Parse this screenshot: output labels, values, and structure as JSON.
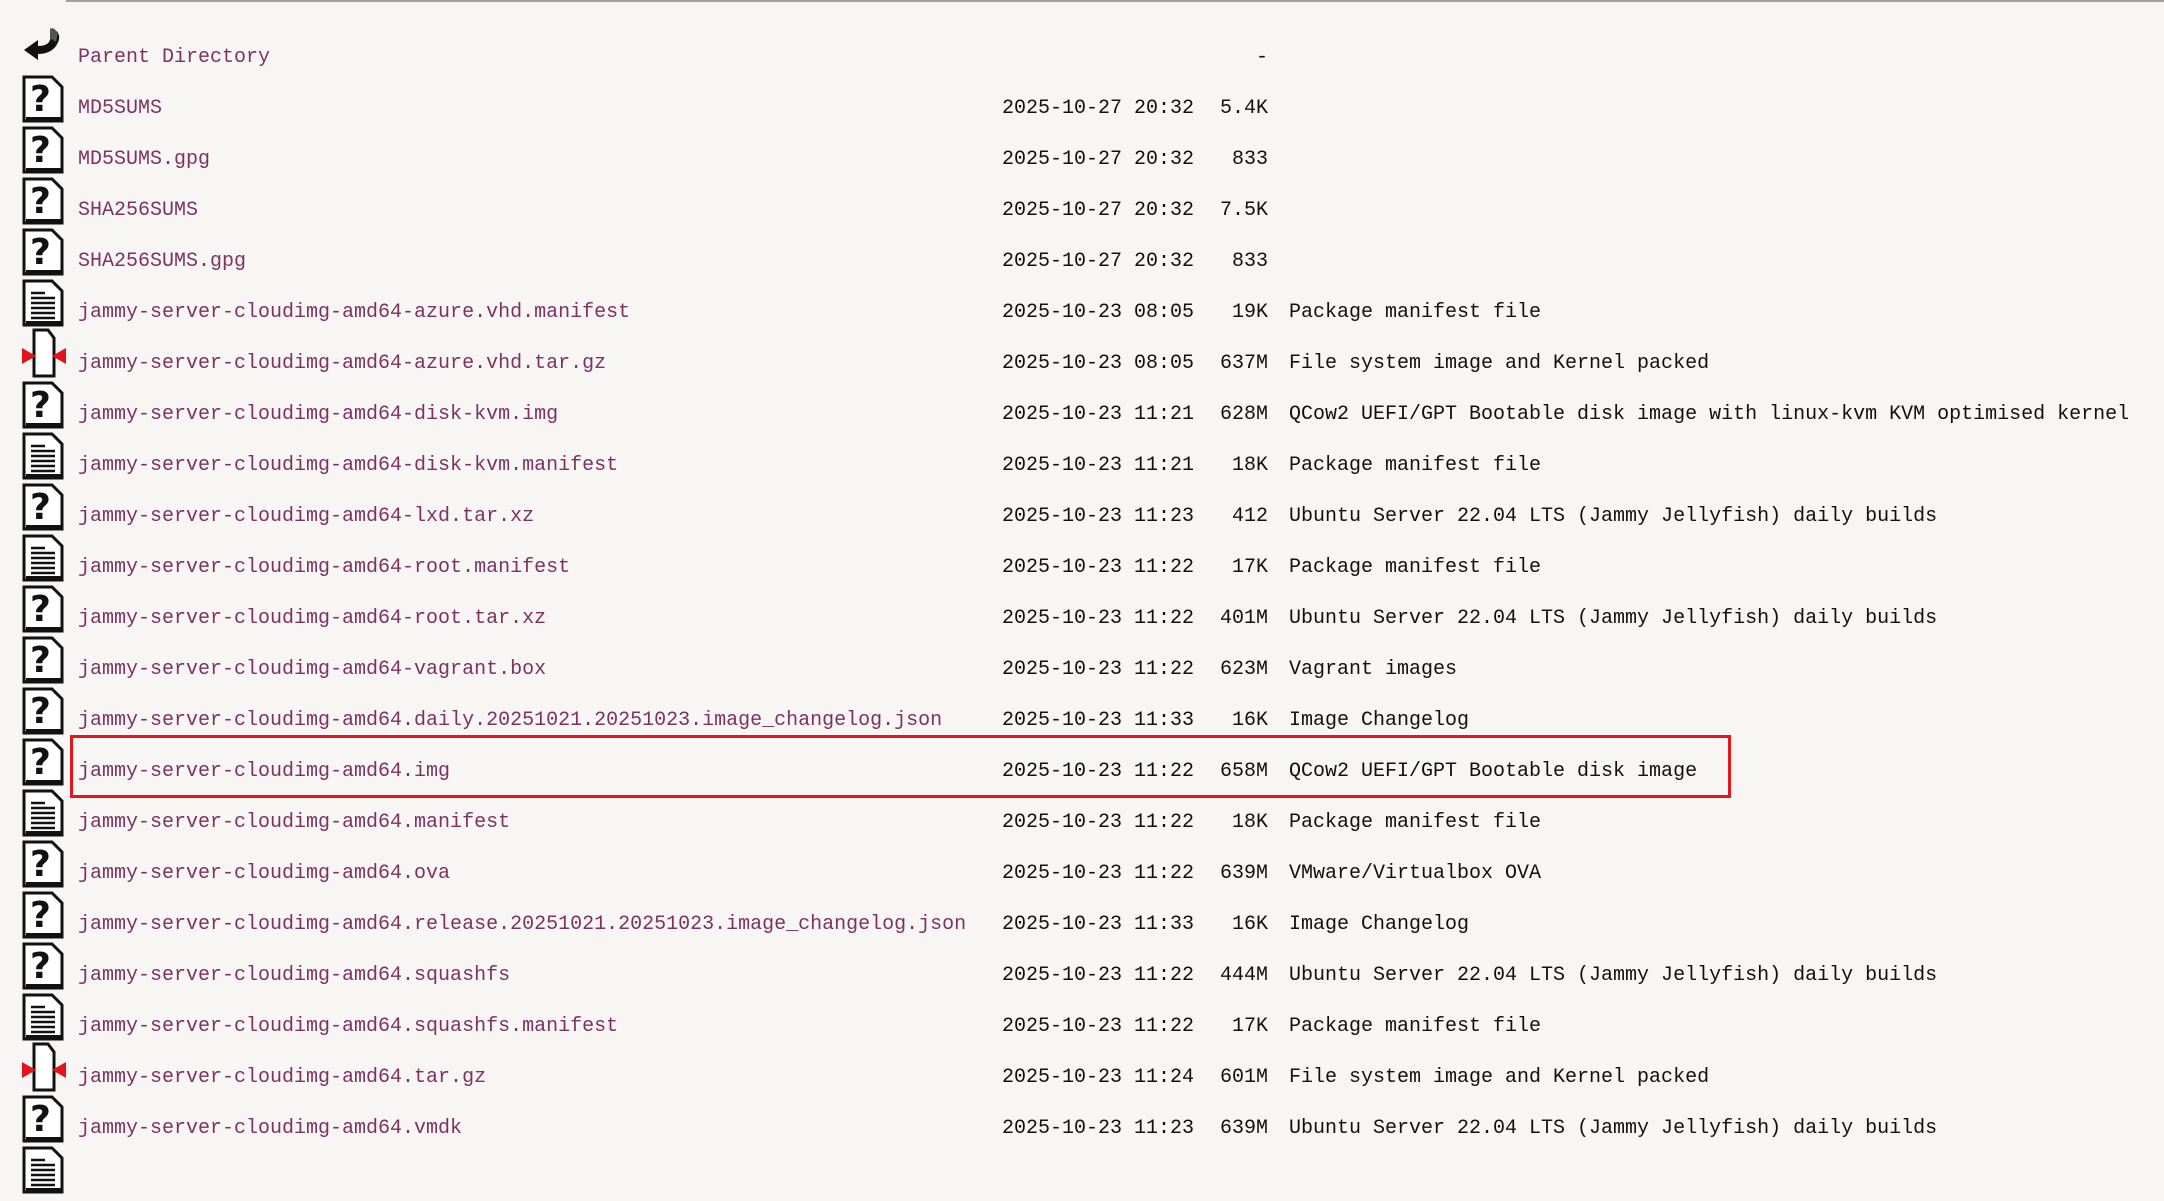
{
  "entries": [
    {
      "name": "Parent Directory",
      "date": "",
      "size": "-",
      "desc": "",
      "icon": "back-icon"
    },
    {
      "name": "MD5SUMS",
      "date": "2025-10-27 20:32",
      "size": "5.4K",
      "desc": "",
      "icon": "unknown-file-icon"
    },
    {
      "name": "MD5SUMS.gpg",
      "date": "2025-10-27 20:32",
      "size": "833",
      "desc": "",
      "icon": "unknown-file-icon"
    },
    {
      "name": "SHA256SUMS",
      "date": "2025-10-27 20:32",
      "size": "7.5K",
      "desc": "",
      "icon": "unknown-file-icon"
    },
    {
      "name": "SHA256SUMS.gpg",
      "date": "2025-10-27 20:32",
      "size": "833",
      "desc": "",
      "icon": "unknown-file-icon"
    },
    {
      "name": "jammy-server-cloudimg-amd64-azure.vhd.manifest",
      "date": "2025-10-23 08:05",
      "size": "19K",
      "desc": "Package manifest file",
      "icon": "text-file-icon"
    },
    {
      "name": "jammy-server-cloudimg-amd64-azure.vhd.tar.gz",
      "date": "2025-10-23 08:05",
      "size": "637M",
      "desc": "File system image and Kernel packed",
      "icon": "compressed-file-icon"
    },
    {
      "name": "jammy-server-cloudimg-amd64-disk-kvm.img",
      "date": "2025-10-23 11:21",
      "size": "628M",
      "desc": "QCow2 UEFI/GPT Bootable disk image with linux-kvm KVM optimised kernel",
      "icon": "unknown-file-icon"
    },
    {
      "name": "jammy-server-cloudimg-amd64-disk-kvm.manifest",
      "date": "2025-10-23 11:21",
      "size": "18K",
      "desc": "Package manifest file",
      "icon": "text-file-icon"
    },
    {
      "name": "jammy-server-cloudimg-amd64-lxd.tar.xz",
      "date": "2025-10-23 11:23",
      "size": "412",
      "desc": "Ubuntu Server 22.04 LTS (Jammy Jellyfish) daily builds",
      "icon": "unknown-file-icon"
    },
    {
      "name": "jammy-server-cloudimg-amd64-root.manifest",
      "date": "2025-10-23 11:22",
      "size": "17K",
      "desc": "Package manifest file",
      "icon": "text-file-icon"
    },
    {
      "name": "jammy-server-cloudimg-amd64-root.tar.xz",
      "date": "2025-10-23 11:22",
      "size": "401M",
      "desc": "Ubuntu Server 22.04 LTS (Jammy Jellyfish) daily builds",
      "icon": "unknown-file-icon"
    },
    {
      "name": "jammy-server-cloudimg-amd64-vagrant.box",
      "date": "2025-10-23 11:22",
      "size": "623M",
      "desc": "Vagrant images",
      "icon": "unknown-file-icon"
    },
    {
      "name": "jammy-server-cloudimg-amd64.daily.20251021.20251023.image_changelog.json",
      "date": "2025-10-23 11:33",
      "size": "16K",
      "desc": "Image Changelog",
      "icon": "unknown-file-icon"
    },
    {
      "name": "jammy-server-cloudimg-amd64.img",
      "date": "2025-10-23 11:22",
      "size": "658M",
      "desc": "QCow2 UEFI/GPT Bootable disk image",
      "icon": "unknown-file-icon"
    },
    {
      "name": "jammy-server-cloudimg-amd64.manifest",
      "date": "2025-10-23 11:22",
      "size": "18K",
      "desc": "Package manifest file",
      "icon": "text-file-icon"
    },
    {
      "name": "jammy-server-cloudimg-amd64.ova",
      "date": "2025-10-23 11:22",
      "size": "639M",
      "desc": "VMware/Virtualbox OVA",
      "icon": "unknown-file-icon"
    },
    {
      "name": "jammy-server-cloudimg-amd64.release.20251021.20251023.image_changelog.json",
      "date": "2025-10-23 11:33",
      "size": "16K",
      "desc": "Image Changelog",
      "icon": "unknown-file-icon"
    },
    {
      "name": "jammy-server-cloudimg-amd64.squashfs",
      "date": "2025-10-23 11:22",
      "size": "444M",
      "desc": "Ubuntu Server 22.04 LTS (Jammy Jellyfish) daily builds",
      "icon": "unknown-file-icon"
    },
    {
      "name": "jammy-server-cloudimg-amd64.squashfs.manifest",
      "date": "2025-10-23 11:22",
      "size": "17K",
      "desc": "Package manifest file",
      "icon": "text-file-icon"
    },
    {
      "name": "jammy-server-cloudimg-amd64.tar.gz",
      "date": "2025-10-23 11:24",
      "size": "601M",
      "desc": "File system image and Kernel packed",
      "icon": "compressed-file-icon"
    },
    {
      "name": "jammy-server-cloudimg-amd64.vmdk",
      "date": "2025-10-23 11:23",
      "size": "639M",
      "desc": "Ubuntu Server 22.04 LTS (Jammy Jellyfish) daily builds",
      "icon": "unknown-file-icon"
    },
    {
      "name": "",
      "date": "",
      "size": "",
      "desc": "",
      "icon": "text-file-icon"
    }
  ],
  "highlighted_index": 14,
  "colors": {
    "link": "#7d3260",
    "highlight": "#e8141c",
    "background": "#f7f6f4"
  }
}
